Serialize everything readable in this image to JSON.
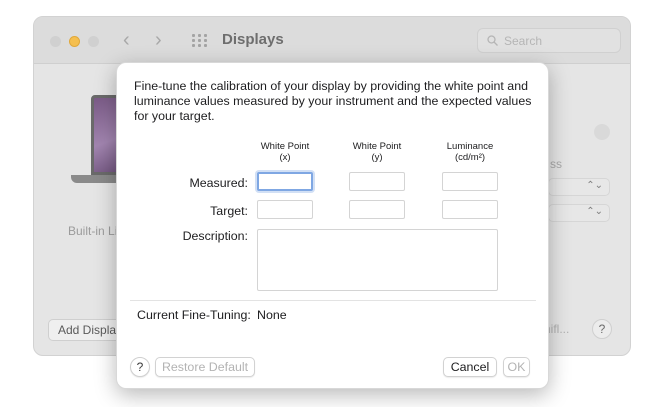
{
  "window": {
    "title": "Displays",
    "search_placeholder": "Search",
    "builtin_label": "Built-in Li",
    "add_display_label": "Add Displa",
    "right_label": "ss",
    "night_shift_label": "hifl...",
    "help_label": "?"
  },
  "sheet": {
    "description": "Fine-tune the calibration of your display by providing the white point and luminance values measured by your instrument and the expected values for your target.",
    "columns": [
      {
        "line1": "White Point",
        "line2": "(x)"
      },
      {
        "line1": "White Point",
        "line2": "(y)"
      },
      {
        "line1": "Luminance",
        "line2": "(cd/m²)"
      }
    ],
    "rows": {
      "measured": "Measured:",
      "target": "Target:",
      "description": "Description:"
    },
    "values": {
      "measured_x": "",
      "measured_y": "",
      "measured_lum": "",
      "target_x": "",
      "target_y": "",
      "target_lum": "",
      "description": ""
    },
    "current_fine_tuning_label": "Current Fine-Tuning:",
    "current_fine_tuning_value": "None",
    "help_label": "?",
    "restore_default_label": "Restore Default",
    "cancel_label": "Cancel",
    "ok_label": "OK"
  }
}
